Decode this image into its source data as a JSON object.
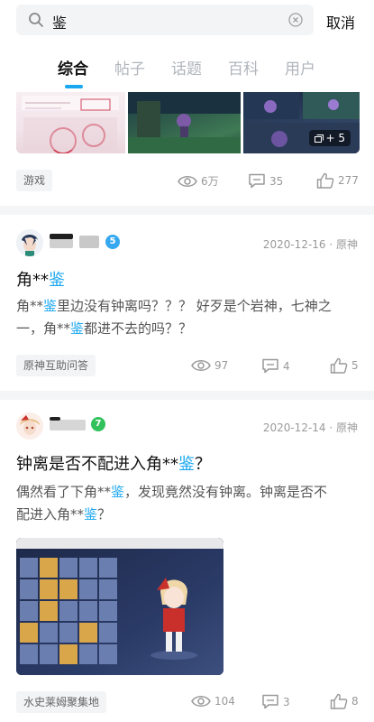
{
  "search": {
    "query": "鉴",
    "cancel_label": "取消"
  },
  "tabs": [
    {
      "label": "综合",
      "active": true
    },
    {
      "label": "帖子",
      "active": false
    },
    {
      "label": "话题",
      "active": false
    },
    {
      "label": "百科",
      "active": false
    },
    {
      "label": "用户",
      "active": false
    }
  ],
  "cards": [
    {
      "tag": "游戏",
      "views": "6万",
      "comments": "35",
      "likes": "277",
      "more_images": "+ 5"
    },
    {
      "meta": "2020-12-16 · 原神",
      "level": "5",
      "title_prefix": "角**",
      "title_hl": "鉴",
      "body_l1_prefix": "角**",
      "body_l1_hl": "鉴",
      "body_l1_suffix": "里边没有钟离吗？？？ 好歹是个岩神，七神之",
      "body_l2_prefix": "一，角**",
      "body_l2_hl": "鉴",
      "body_l2_suffix": "都进不去的吗？？",
      "tag": "原神互助问答",
      "views": "97",
      "comments": "4",
      "likes": "5"
    },
    {
      "meta": "2020-12-14 · 原神",
      "level": "7",
      "title_prefix": "钟离是否不配进入角**",
      "title_hl": "鉴",
      "title_suffix": "？",
      "body_l1_prefix": "偶然看了下角**",
      "body_l1_hl": "鉴",
      "body_l1_suffix": "，发现竟然没有钟离。钟离是否不",
      "body_l2_prefix": "配进入角**",
      "body_l2_hl": "鉴",
      "body_l2_suffix": "？",
      "tag": "水史莱姆聚集地",
      "views": "104",
      "comments": "3",
      "likes": "8"
    }
  ],
  "colors": {
    "accent": "#1aa7f0",
    "level5": "#35a8f0",
    "level7": "#33c15b"
  },
  "icons": [
    "search-icon",
    "clear-icon",
    "eye-icon",
    "comment-icon",
    "thumb-up-icon",
    "image-stack-icon"
  ]
}
